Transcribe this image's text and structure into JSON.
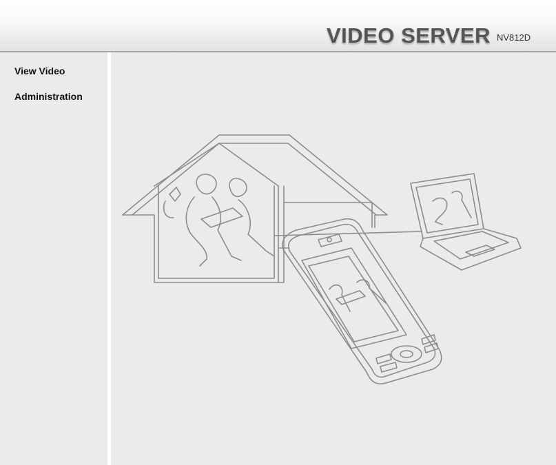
{
  "header": {
    "brand_title": "VIDEO SERVER",
    "model": "NV812D"
  },
  "sidebar": {
    "items": [
      {
        "label": "View Video"
      },
      {
        "label": "Administration"
      }
    ]
  },
  "icons": {
    "illustration": "house-phone-laptop-illustration"
  },
  "colors": {
    "background": "#ebebeb",
    "line_art": "#8c8c8c",
    "brand_text": "#555555"
  }
}
